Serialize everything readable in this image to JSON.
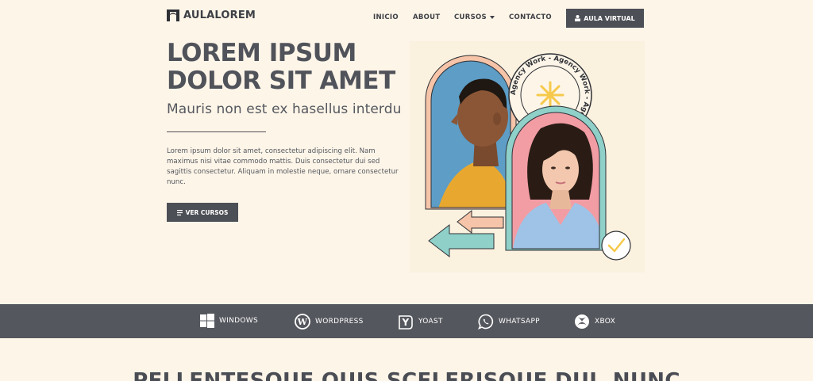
{
  "header": {
    "logo_text": "AULALOREM",
    "nav": [
      {
        "label": "INICIO"
      },
      {
        "label": "ABOUT"
      },
      {
        "label": "CURSOS"
      },
      {
        "label": "CONTACTO"
      }
    ],
    "cta_label": "AULA VIRTUAL"
  },
  "hero": {
    "title": "LOREM IPSUM DOLOR SIT AMET",
    "subtitle": "Mauris non est ex hasellus interdu",
    "body": "Lorem ipsum dolor sit amet, consectetur adipiscing elit. Nam maximus nisi vitae commodo mattis. Duis consectetur dui sed sagittis consectetur. Aliquam in molestie neque, ornare consectetur nunc.",
    "button_label": "VER CURSOS",
    "badge_text": "Agency Work - Agency Work - Agency Work - "
  },
  "brands": [
    {
      "label": "WINDOWS",
      "icon": "windows-icon"
    },
    {
      "label": "WORDPRESS",
      "icon": "wordpress-icon"
    },
    {
      "label": "YOAST",
      "icon": "yoast-icon"
    },
    {
      "label": "WHATSAPP",
      "icon": "whatsapp-icon"
    },
    {
      "label": "XBOX",
      "icon": "xbox-icon"
    }
  ],
  "section": {
    "heading": "PELLENTESQUE QUIS SCELERISQUE DUI, NUNC"
  },
  "colors": {
    "background": "#fdf5e8",
    "dark": "#4d4f56",
    "peach": "#f6c4a8",
    "teal": "#8fd0c9",
    "pink": "#f29ca4",
    "yellow": "#f6c94b"
  }
}
